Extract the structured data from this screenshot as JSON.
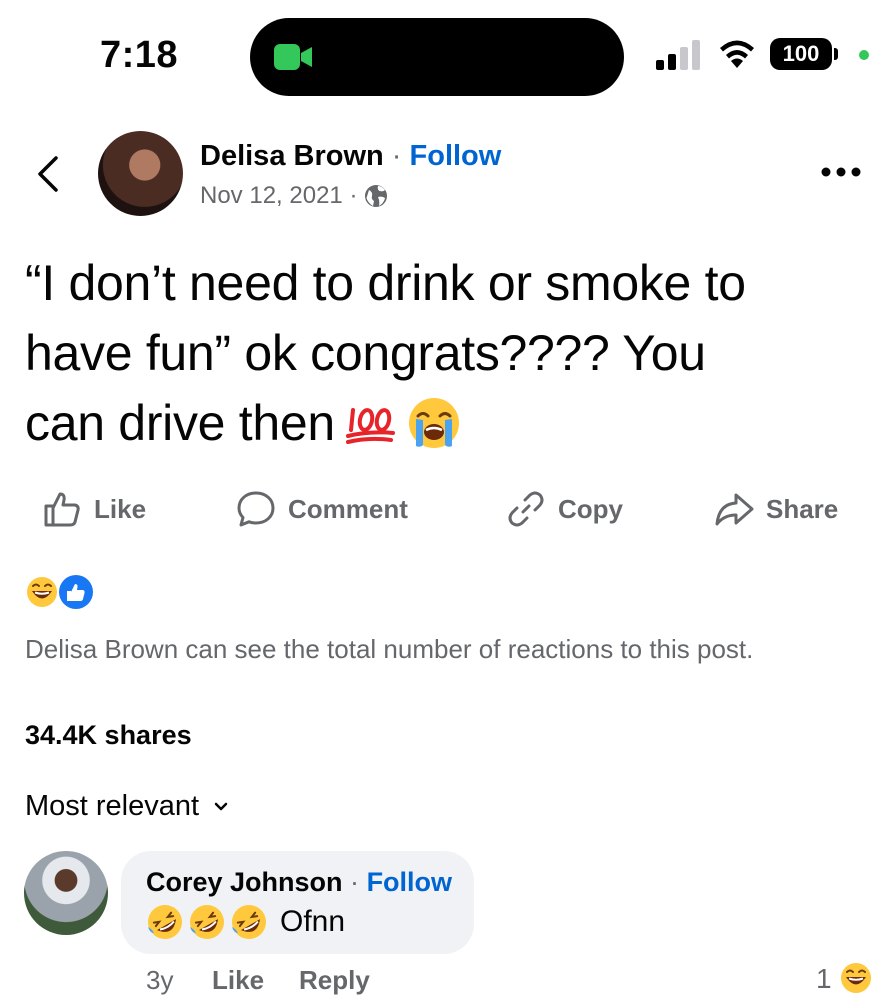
{
  "status_bar": {
    "time": "7:18",
    "battery": "100"
  },
  "post": {
    "author": "Delisa Brown",
    "separator": "·",
    "follow": "Follow",
    "date": "Nov 12, 2021 ·",
    "text_line1": "“I don’t need to drink or smoke to",
    "text_line2": "have fun” ok congrats???? You",
    "text_line3": "can drive then"
  },
  "actions": {
    "like": "Like",
    "comment": "Comment",
    "copy": "Copy",
    "share": "Share"
  },
  "reactions_note": "Delisa Brown can see the total number of reactions to this post.",
  "shares": "34.4K shares",
  "sort_label": "Most relevant",
  "comment": {
    "author": "Corey Johnson",
    "separator": "·",
    "follow": "Follow",
    "text": "Ofnn",
    "time": "3y",
    "like": "Like",
    "reply": "Reply",
    "reaction_count": "1"
  },
  "colors": {
    "link": "#0064d1",
    "secondary_text": "#65676b",
    "bubble": "#f0f2f5",
    "recording_dot": "#34c759"
  },
  "icons": [
    "facetime-camera-icon",
    "cellular-signal-icon",
    "wifi-icon",
    "battery-icon",
    "back-chevron-icon",
    "globe-icon",
    "more-dots-icon",
    "hundred-points-emoji",
    "loudly-crying-emoji",
    "thumbs-up-icon",
    "comment-icon",
    "link-icon",
    "share-arrow-icon",
    "laughing-reaction-icon",
    "like-reaction-icon",
    "chevron-down-icon",
    "rofl-emoji",
    "laughing-emoji"
  ]
}
